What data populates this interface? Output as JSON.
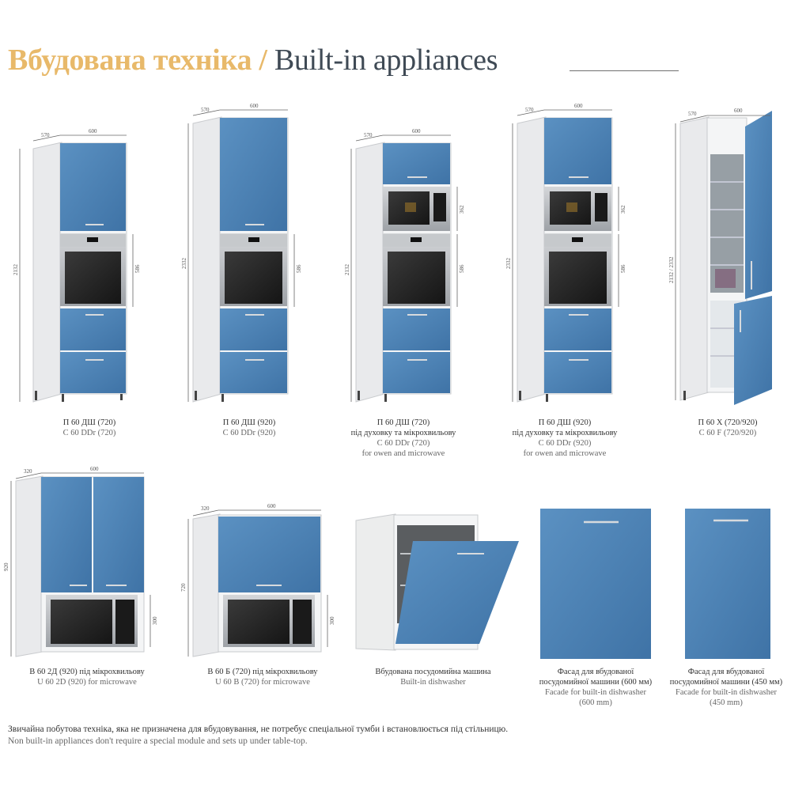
{
  "header": {
    "title_ua": "Вбудована техніка",
    "title_sep": " / ",
    "title_en": "Built-in appliances"
  },
  "colors": {
    "facade": "#4e83b5",
    "facade_dark": "#3e6f9f",
    "carcass": "#f2f3f4",
    "oven": "#2b2b2b",
    "steel": "#b9bcc0",
    "title_gold": "#e8b96a"
  },
  "dimensions": {
    "d570": "570",
    "d600": "600",
    "d320": "320",
    "d2132": "2132",
    "d2332": "2332",
    "d586": "586",
    "d362": "362",
    "d920": "920",
    "d720": "720",
    "d300": "300",
    "d2132_2332": "2132 / 2332"
  },
  "products": [
    {
      "name": "П 60 ДШ (720)",
      "sub": "C 60 DDr (720)"
    },
    {
      "name": "П 60 ДШ (920)",
      "sub": "C 60 DDr (920)"
    },
    {
      "name": "П 60 ДШ (720)",
      "line2": "під духовку та мікрохвильову",
      "sub": "C 60 DDr (720)",
      "sub2": "for owen and microwave"
    },
    {
      "name": "П 60 ДШ (920)",
      "line2": "під духовку та мікрохвильову",
      "sub": "C 60 DDr (920)",
      "sub2": "for owen and microwave"
    },
    {
      "name": "П 60 Х (720/920)",
      "sub": "C 60 F (720/920)"
    },
    {
      "name": "В 60 2Д (920) під мікрохвильову",
      "sub": "U 60 2D (920) for microwave"
    },
    {
      "name": "В 60 Б (720) під мікрохвильову",
      "sub": "U 60 B (720) for microwave"
    },
    {
      "name": "Вбудована посудомийна машина",
      "sub": "Built-in dishwasher"
    },
    {
      "name": "Фасад для вбудованої",
      "line2": "посудомийної машини (600 мм)",
      "sub": "Facade for built-in dishwasher",
      "sub2": "(600 mm)"
    },
    {
      "name": "Фасад для вбудованої",
      "line2": "посудомийної машини (450 мм)",
      "sub": "Facade for built-in dishwasher",
      "sub2": "(450 mm)"
    }
  ],
  "footer": {
    "note_ua": "Звичайна побутова техніка, яка не призначена для вбудовування, не потребує спеціальної тумби і встановлюється під стільницю.",
    "note_en": "Non built-in appliances don't require a special module and sets up under table-top."
  }
}
